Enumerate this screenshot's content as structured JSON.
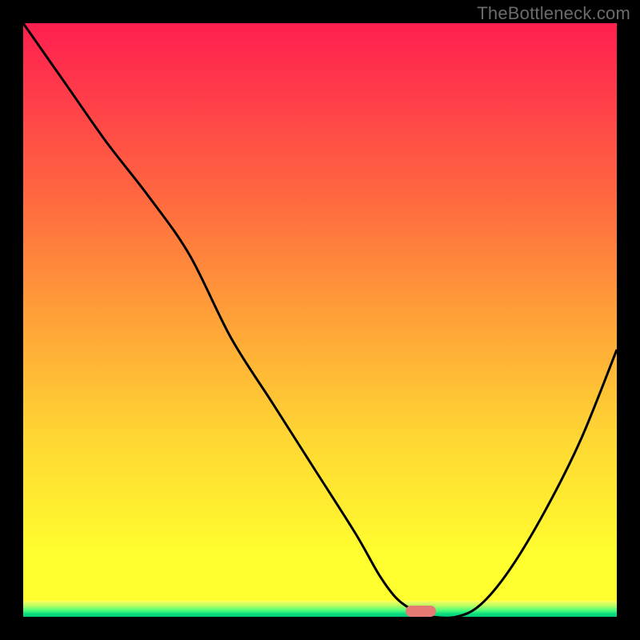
{
  "watermark": "TheBottleneck.com",
  "colors": {
    "curve": "#000000",
    "marker": "#e77b73",
    "background_top": "#ff1f4f",
    "background_bottom": "#00c97b"
  },
  "chart_data": {
    "type": "line",
    "title": "",
    "xlabel": "",
    "ylabel": "",
    "xlim": [
      0,
      100
    ],
    "ylim": [
      0,
      100
    ],
    "grid": false,
    "series": [
      {
        "name": "bottleneck-curve",
        "x": [
          0,
          7,
          14,
          21,
          28,
          35,
          42,
          49,
          56,
          60,
          63,
          66,
          69,
          73,
          77,
          82,
          88,
          94,
          100
        ],
        "values": [
          100,
          90,
          80,
          71,
          61,
          47,
          36,
          25,
          14,
          7,
          3,
          1,
          0,
          0,
          2,
          8,
          18,
          30,
          45
        ]
      }
    ],
    "annotations": [
      {
        "name": "valley-marker",
        "x": 67,
        "y": 1
      }
    ]
  }
}
